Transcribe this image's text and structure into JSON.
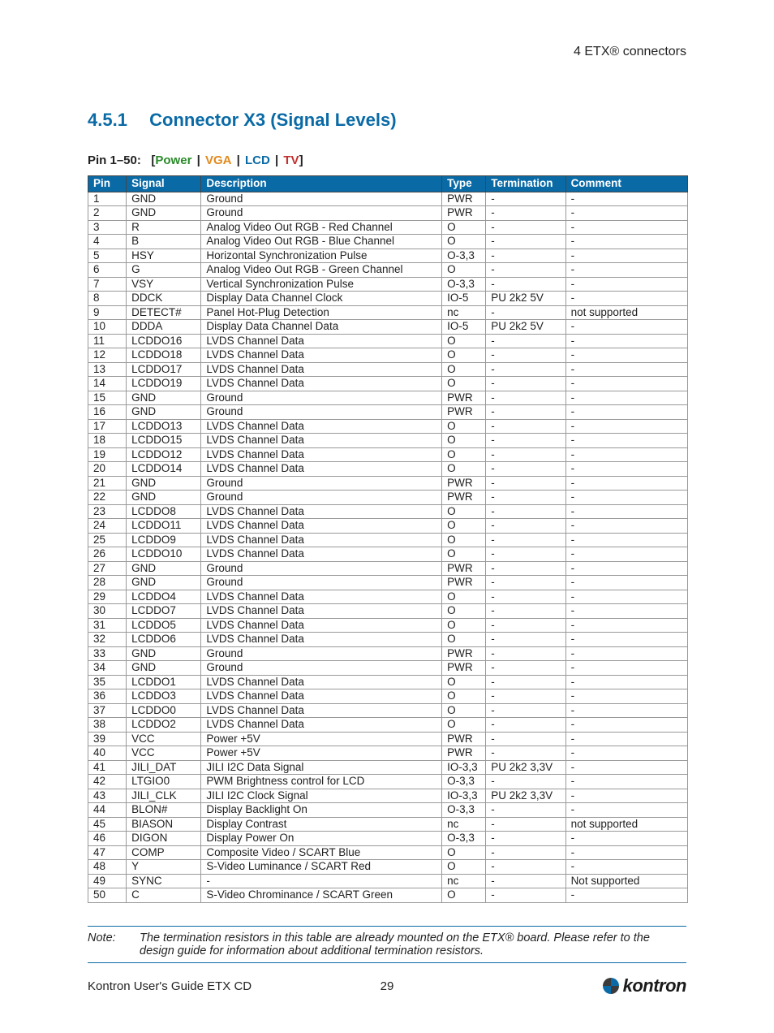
{
  "header": {
    "right": "4 ETX® connectors"
  },
  "section": {
    "number": "4.5.1",
    "title": "Connector X3 (Signal Levels)"
  },
  "legend": {
    "prefix": "Pin 1–50:",
    "items": [
      {
        "label": "Power",
        "cls": "power"
      },
      {
        "label": "VGA",
        "cls": "vga"
      },
      {
        "label": "LCD",
        "cls": "lcd"
      },
      {
        "label": "TV",
        "cls": "tv"
      }
    ]
  },
  "columns": [
    "Pin",
    "Signal",
    "Description",
    "Type",
    "Termination",
    "Comment"
  ],
  "rows": [
    {
      "pin": "1",
      "sig": "GND",
      "desc": "Ground",
      "dcls": "power",
      "type": "PWR",
      "term": "-",
      "comm": "-"
    },
    {
      "pin": "2",
      "sig": "GND",
      "desc": "Ground",
      "dcls": "power",
      "type": "PWR",
      "term": "-",
      "comm": "-"
    },
    {
      "pin": "3",
      "sig": "R",
      "desc": "Analog Video Out RGB - Red Channel",
      "dcls": "vga",
      "type": "O",
      "term": "-",
      "comm": "-"
    },
    {
      "pin": "4",
      "sig": "B",
      "desc": "Analog Video Out RGB - Blue Channel",
      "dcls": "vga",
      "type": "O",
      "term": "-",
      "comm": "-"
    },
    {
      "pin": "5",
      "sig": "HSY",
      "desc": "Horizontal Synchronization Pulse",
      "dcls": "vga",
      "type": "O-3,3",
      "term": "-",
      "comm": "-"
    },
    {
      "pin": "6",
      "sig": "G",
      "desc": "Analog Video Out RGB - Green Channel",
      "dcls": "vga",
      "type": "O",
      "term": "-",
      "comm": "-"
    },
    {
      "pin": "7",
      "sig": "VSY",
      "desc": "Vertical Synchronization Pulse",
      "dcls": "vga",
      "type": "O-3,3",
      "term": "-",
      "comm": "-"
    },
    {
      "pin": "8",
      "sig": "DDCK",
      "desc": "Display Data Channel Clock",
      "dcls": "vga",
      "type": "IO-5",
      "term": "PU 2k2 5V",
      "comm": "-"
    },
    {
      "pin": "9",
      "sig": "DETECT#",
      "desc": "Panel Hot-Plug Detection",
      "dcls": "lcd",
      "type": "nc",
      "term": "-",
      "comm": "not supported"
    },
    {
      "pin": "10",
      "sig": "DDDA",
      "desc": "Display Data Channel Data",
      "dcls": "vga",
      "type": "IO-5",
      "term": "PU 2k2 5V",
      "comm": "-"
    },
    {
      "pin": "11",
      "sig": "LCDDO16",
      "desc": "LVDS Channel Data",
      "dcls": "lcd",
      "type": "O",
      "term": "-",
      "comm": "-"
    },
    {
      "pin": "12",
      "sig": "LCDDO18",
      "desc": "LVDS Channel Data",
      "dcls": "lcd",
      "type": "O",
      "term": "-",
      "comm": "-"
    },
    {
      "pin": "13",
      "sig": "LCDDO17",
      "desc": "LVDS Channel Data",
      "dcls": "lcd",
      "type": "O",
      "term": "-",
      "comm": "-"
    },
    {
      "pin": "14",
      "sig": "LCDDO19",
      "desc": "LVDS Channel Data",
      "dcls": "lcd",
      "type": "O",
      "term": "-",
      "comm": "-"
    },
    {
      "pin": "15",
      "sig": "GND",
      "desc": "Ground",
      "dcls": "power",
      "type": "PWR",
      "term": "-",
      "comm": "-"
    },
    {
      "pin": "16",
      "sig": "GND",
      "desc": "Ground",
      "dcls": "power",
      "type": "PWR",
      "term": "-",
      "comm": "-"
    },
    {
      "pin": "17",
      "sig": "LCDDO13",
      "desc": "LVDS Channel Data",
      "dcls": "lcd",
      "type": "O",
      "term": "-",
      "comm": "-"
    },
    {
      "pin": "18",
      "sig": "LCDDO15",
      "desc": "LVDS Channel Data",
      "dcls": "lcd",
      "type": "O",
      "term": "-",
      "comm": "-"
    },
    {
      "pin": "19",
      "sig": "LCDDO12",
      "desc": "LVDS Channel Data",
      "dcls": "lcd",
      "type": "O",
      "term": "-",
      "comm": "-"
    },
    {
      "pin": "20",
      "sig": "LCDDO14",
      "desc": "LVDS Channel Data",
      "dcls": "lcd",
      "type": "O",
      "term": "-",
      "comm": "-"
    },
    {
      "pin": "21",
      "sig": "GND",
      "desc": "Ground",
      "dcls": "power",
      "type": "PWR",
      "term": "-",
      "comm": "-"
    },
    {
      "pin": "22",
      "sig": "GND",
      "desc": "Ground",
      "dcls": "power",
      "type": "PWR",
      "term": "-",
      "comm": "-"
    },
    {
      "pin": "23",
      "sig": "LCDDO8",
      "desc": "LVDS Channel Data",
      "dcls": "lcd",
      "type": "O",
      "term": "-",
      "comm": "-"
    },
    {
      "pin": "24",
      "sig": "LCDDO11",
      "desc": "LVDS Channel Data",
      "dcls": "lcd",
      "type": "O",
      "term": "-",
      "comm": "-"
    },
    {
      "pin": "25",
      "sig": "LCDDO9",
      "desc": "LVDS Channel Data",
      "dcls": "lcd",
      "type": "O",
      "term": "-",
      "comm": "-"
    },
    {
      "pin": "26",
      "sig": "LCDDO10",
      "desc": "LVDS Channel Data",
      "dcls": "lcd",
      "type": "O",
      "term": "-",
      "comm": "-"
    },
    {
      "pin": "27",
      "sig": "GND",
      "desc": "Ground",
      "dcls": "power",
      "type": "PWR",
      "term": "-",
      "comm": "-"
    },
    {
      "pin": "28",
      "sig": "GND",
      "desc": "Ground",
      "dcls": "power",
      "type": "PWR",
      "term": "-",
      "comm": "-"
    },
    {
      "pin": "29",
      "sig": "LCDDO4",
      "desc": "LVDS Channel Data",
      "dcls": "lcd",
      "type": "O",
      "term": "-",
      "comm": "-"
    },
    {
      "pin": "30",
      "sig": "LCDDO7",
      "desc": "LVDS Channel Data",
      "dcls": "lcd",
      "type": "O",
      "term": "-",
      "comm": "-"
    },
    {
      "pin": "31",
      "sig": "LCDDO5",
      "desc": "LVDS Channel Data",
      "dcls": "lcd",
      "type": "O",
      "term": "-",
      "comm": "-"
    },
    {
      "pin": "32",
      "sig": "LCDDO6",
      "desc": "LVDS Channel Data",
      "dcls": "lcd",
      "type": "O",
      "term": "-",
      "comm": "-"
    },
    {
      "pin": "33",
      "sig": "GND",
      "desc": "Ground",
      "dcls": "power",
      "type": "PWR",
      "term": "-",
      "comm": "-"
    },
    {
      "pin": "34",
      "sig": "GND",
      "desc": "Ground",
      "dcls": "power",
      "type": "PWR",
      "term": "-",
      "comm": "-"
    },
    {
      "pin": "35",
      "sig": "LCDDO1",
      "desc": "LVDS Channel Data",
      "dcls": "lcd",
      "type": "O",
      "term": "-",
      "comm": "-"
    },
    {
      "pin": "36",
      "sig": "LCDDO3",
      "desc": "LVDS Channel Data",
      "dcls": "lcd",
      "type": "O",
      "term": "-",
      "comm": "-"
    },
    {
      "pin": "37",
      "sig": "LCDDO0",
      "desc": "LVDS Channel Data",
      "dcls": "lcd",
      "type": "O",
      "term": "-",
      "comm": "-"
    },
    {
      "pin": "38",
      "sig": "LCDDO2",
      "desc": "LVDS Channel Data",
      "dcls": "lcd",
      "type": "O",
      "term": "-",
      "comm": "-"
    },
    {
      "pin": "39",
      "sig": "VCC",
      "desc": "Power +5V",
      "dcls": "power",
      "type": "PWR",
      "term": "-",
      "comm": "-"
    },
    {
      "pin": "40",
      "sig": "VCC",
      "desc": "Power +5V",
      "dcls": "power",
      "type": "PWR",
      "term": "-",
      "comm": "-"
    },
    {
      "pin": "41",
      "sig": "JILI_DAT",
      "desc": "JILI I2C Data Signal",
      "dcls": "lcd",
      "type": "IO-3,3",
      "term": "PU 2k2 3,3V",
      "comm": "-"
    },
    {
      "pin": "42",
      "sig": "LTGIO0",
      "desc": "PWM Brightness control for LCD",
      "dcls": "lcd",
      "type": "O-3,3",
      "term": "-",
      "comm": "-"
    },
    {
      "pin": "43",
      "sig": "JILI_CLK",
      "desc": "JILI I2C Clock Signal",
      "dcls": "lcd",
      "type": "IO-3,3",
      "term": "PU 2k2 3,3V",
      "comm": "-"
    },
    {
      "pin": "44",
      "sig": "BLON#",
      "desc": "Display Backlight On",
      "dcls": "lcd",
      "type": "O-3,3",
      "term": "-",
      "comm": "-"
    },
    {
      "pin": "45",
      "sig": "BIASON",
      "desc": "Display Contrast",
      "dcls": "lcd",
      "type": "nc",
      "term": "-",
      "comm": "not supported"
    },
    {
      "pin": "46",
      "sig": "DIGON",
      "desc": "Display Power On",
      "dcls": "lcd",
      "type": "O-3,3",
      "term": "-",
      "comm": "-"
    },
    {
      "pin": "47",
      "sig": "COMP",
      "desc": "Composite Video / SCART Blue",
      "dcls": "tv",
      "type": "O",
      "term": "-",
      "comm": "-"
    },
    {
      "pin": "48",
      "sig": "Y",
      "desc": "S-Video Luminance / SCART Red",
      "dcls": "tv",
      "type": "O",
      "term": "-",
      "comm": "-"
    },
    {
      "pin": "49",
      "sig": "SYNC",
      "desc": "-",
      "dcls": "",
      "type": "nc",
      "term": "-",
      "comm": "Not supported"
    },
    {
      "pin": "50",
      "sig": "C",
      "desc": "S-Video Chrominance / SCART Green",
      "dcls": "tv",
      "type": "O",
      "term": "-",
      "comm": "-"
    }
  ],
  "note": {
    "label": "Note:",
    "text": "The termination resistors in this table are already mounted on the ETX® board. Please refer to the design guide for information about additional termination resistors."
  },
  "footer": {
    "left": "Kontron User's Guide ETX CD",
    "page": "29",
    "brand": "kontron"
  }
}
